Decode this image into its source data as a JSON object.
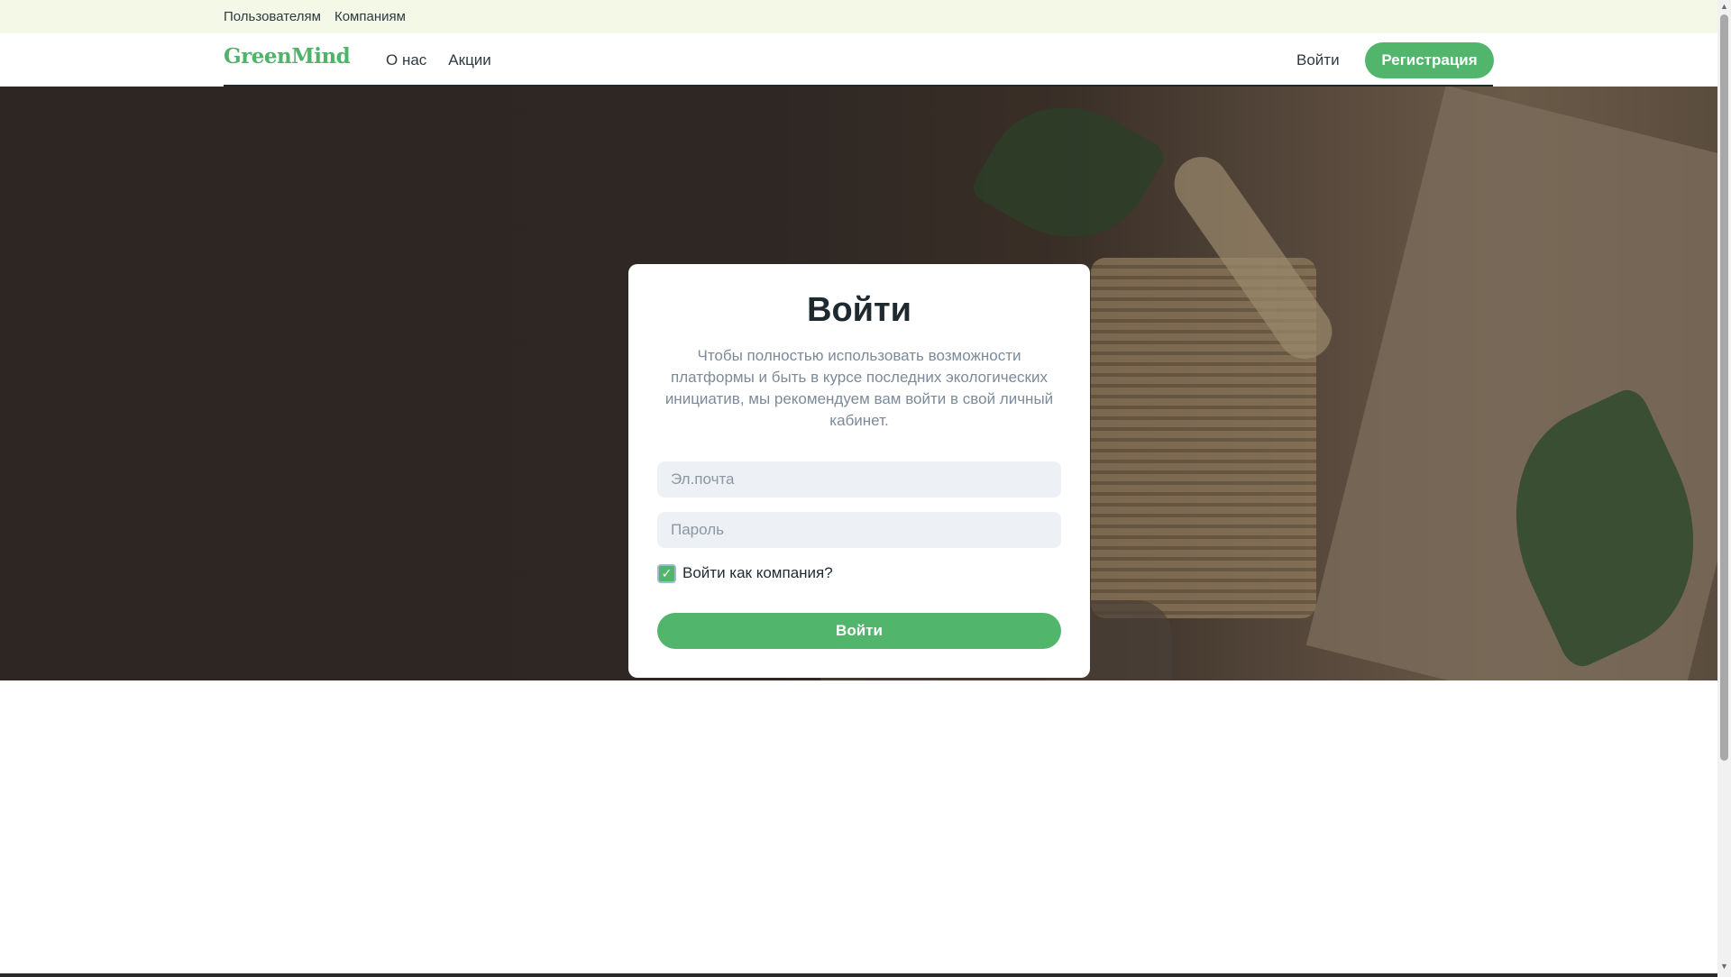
{
  "topbar": {
    "links": [
      "Пользователям",
      "Компаниям"
    ]
  },
  "header": {
    "logo": "GreenMind",
    "nav": [
      "О нас",
      "Акции"
    ],
    "login_label": "Войти",
    "register_label": "Регистрация"
  },
  "login_card": {
    "title": "Войти",
    "description": "Чтобы полностью использовать возможности платформы и быть в курсе последних экологических инициатив, мы рекомендуем вам войти в свой личный кабинет.",
    "email_placeholder": "Эл.почта",
    "password_placeholder": "Пароль",
    "company_checkbox_label": "Войти как компания?",
    "company_checkbox_checked": true,
    "checkmark": "✓",
    "submit_label": "Войти"
  },
  "colors": {
    "accent": "#52b56c",
    "topbar_bg": "#f4f8e6",
    "text_muted": "#7c8a99"
  },
  "scrollbar": {
    "up_arrow": "▲",
    "down_arrow": "▼"
  }
}
